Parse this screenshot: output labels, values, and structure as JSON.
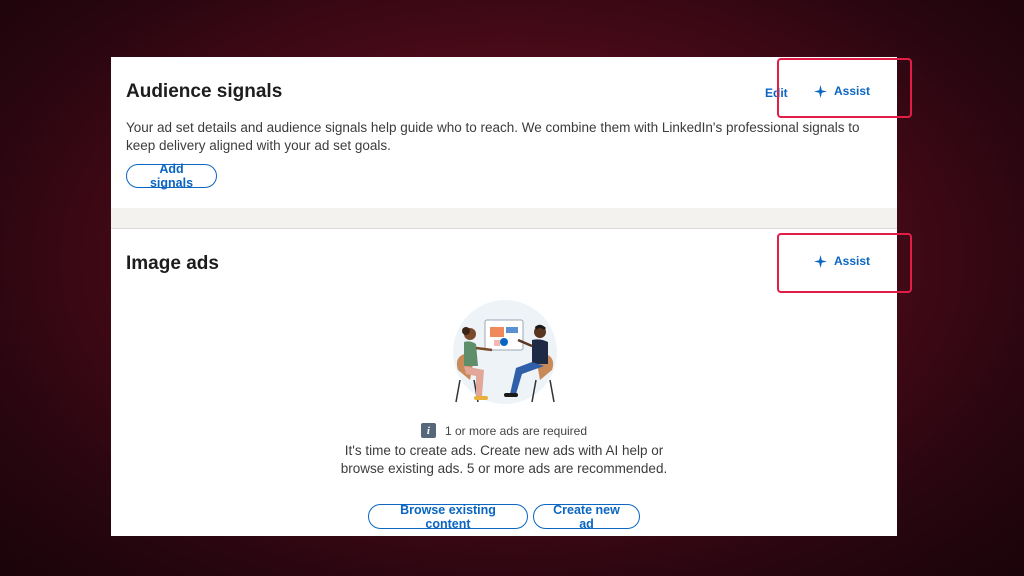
{
  "audience": {
    "title": "Audience signals",
    "edit_label": "Edit",
    "assist_label": "Assist",
    "description": "Your ad set details and audience signals help guide who to reach. We combine them with LinkedIn's professional signals to keep delivery aligned with your ad set goals.",
    "add_signals_label": "Add signals"
  },
  "image_ads": {
    "title": "Image ads",
    "assist_label": "Assist",
    "requirement": "1 or more ads are required",
    "body": "It's time to create ads. Create new ads with AI help or browse existing ads. 5 or more ads are recommended.",
    "browse_label": "Browse existing content",
    "create_label": "Create new ad"
  },
  "icons": {
    "assist": "sparkle-icon",
    "info": "info-icon"
  },
  "colors": {
    "brand_blue": "#0a66c2",
    "highlight_red": "#e11d48",
    "background": "#4a0a18"
  }
}
